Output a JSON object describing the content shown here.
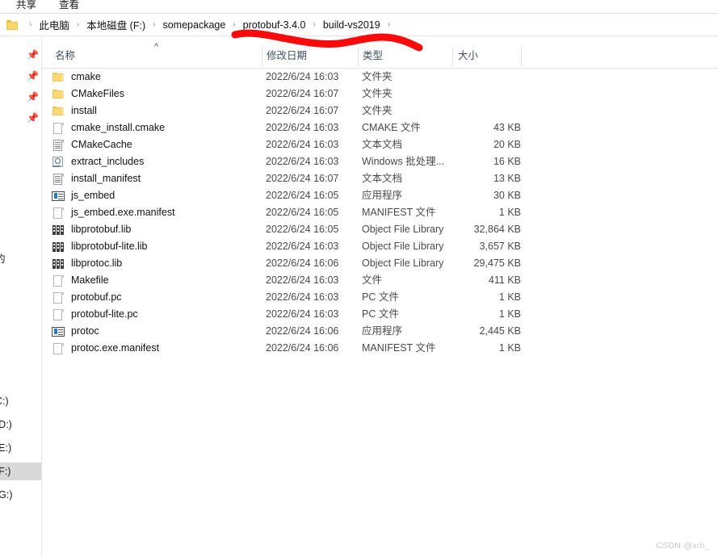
{
  "ribbon": {
    "tabs": [
      {
        "label": "共享",
        "name": "ribbon-tab-share"
      },
      {
        "label": "查看",
        "name": "ribbon-tab-view"
      }
    ]
  },
  "addressbar": {
    "folder_icon": "folder-icon",
    "separator": "›",
    "crumbs": [
      "此电脑",
      "本地磁盘 (F:)",
      "somepackage",
      "protobuf-3.4.0",
      "build-vs2019"
    ]
  },
  "navpane": {
    "pin_icon": "pin-icon",
    "pin_count": 4,
    "cut_label": "的",
    "drives": [
      {
        "label": "C:)",
        "selected": false
      },
      {
        "label": "(D:)",
        "selected": false
      },
      {
        "label": "(E:)",
        "selected": false
      },
      {
        "label": "(F:)",
        "selected": true
      },
      {
        "label": "(G:)",
        "selected": false
      }
    ]
  },
  "columns": {
    "sort_caret": "^",
    "headers": [
      {
        "label": "名称",
        "name": "column-header-name"
      },
      {
        "label": "修改日期",
        "name": "column-header-date-modified"
      },
      {
        "label": "类型",
        "name": "column-header-type"
      },
      {
        "label": "大小",
        "name": "column-header-size"
      }
    ]
  },
  "files": [
    {
      "name": "cmake",
      "icon": "folder",
      "date": "2022/6/24 16:03",
      "type": "文件夹",
      "size": ""
    },
    {
      "name": "CMakeFiles",
      "icon": "folder",
      "date": "2022/6/24 16:07",
      "type": "文件夹",
      "size": ""
    },
    {
      "name": "install",
      "icon": "folder",
      "date": "2022/6/24 16:07",
      "type": "文件夹",
      "size": ""
    },
    {
      "name": "cmake_install.cmake",
      "icon": "page",
      "date": "2022/6/24 16:03",
      "type": "CMAKE 文件",
      "size": "43 KB"
    },
    {
      "name": "CMakeCache",
      "icon": "doc",
      "date": "2022/6/24 16:03",
      "type": "文本文档",
      "size": "20 KB"
    },
    {
      "name": "extract_includes",
      "icon": "bat",
      "date": "2022/6/24 16:03",
      "type": "Windows 批处理...",
      "size": "16 KB"
    },
    {
      "name": "install_manifest",
      "icon": "doc",
      "date": "2022/6/24 16:07",
      "type": "文本文档",
      "size": "13 KB"
    },
    {
      "name": "js_embed",
      "icon": "exe",
      "date": "2022/6/24 16:05",
      "type": "应用程序",
      "size": "30 KB"
    },
    {
      "name": "js_embed.exe.manifest",
      "icon": "page",
      "date": "2022/6/24 16:05",
      "type": "MANIFEST 文件",
      "size": "1 KB"
    },
    {
      "name": "libprotobuf.lib",
      "icon": "lib",
      "date": "2022/6/24 16:05",
      "type": "Object File Library",
      "size": "32,864 KB"
    },
    {
      "name": "libprotobuf-lite.lib",
      "icon": "lib",
      "date": "2022/6/24 16:03",
      "type": "Object File Library",
      "size": "3,657 KB"
    },
    {
      "name": "libprotoc.lib",
      "icon": "lib",
      "date": "2022/6/24 16:06",
      "type": "Object File Library",
      "size": "29,475 KB"
    },
    {
      "name": "Makefile",
      "icon": "page",
      "date": "2022/6/24 16:03",
      "type": "文件",
      "size": "411 KB"
    },
    {
      "name": "protobuf.pc",
      "icon": "page",
      "date": "2022/6/24 16:03",
      "type": "PC 文件",
      "size": "1 KB"
    },
    {
      "name": "protobuf-lite.pc",
      "icon": "page",
      "date": "2022/6/24 16:03",
      "type": "PC 文件",
      "size": "1 KB"
    },
    {
      "name": "protoc",
      "icon": "exe",
      "date": "2022/6/24 16:06",
      "type": "应用程序",
      "size": "2,445 KB"
    },
    {
      "name": "protoc.exe.manifest",
      "icon": "page",
      "date": "2022/6/24 16:06",
      "type": "MANIFEST 文件",
      "size": "1 KB"
    }
  ],
  "annotation": {
    "name": "red-underline-annotation",
    "color": "#fa0a0a"
  },
  "watermark": {
    "text": "CSDN @xrh_"
  }
}
